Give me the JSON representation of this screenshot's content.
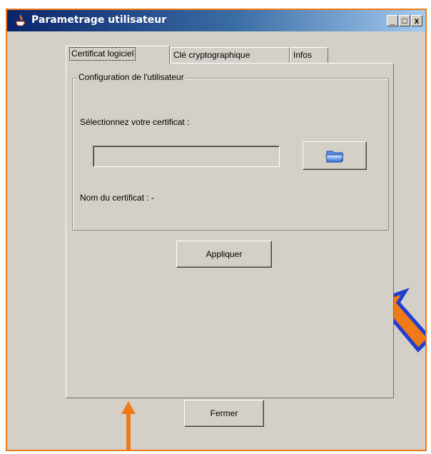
{
  "window": {
    "title": "Parametrage utilisateur",
    "controls": {
      "minimize": "_",
      "maximize": "□",
      "close": "x"
    }
  },
  "tabs": [
    {
      "label": "Certificat logiciel",
      "active": true
    },
    {
      "label": "Clé cryptographique",
      "active": false
    },
    {
      "label": "Infos",
      "active": false
    }
  ],
  "panel": {
    "group_title": "Configuration de l'utilisateur",
    "select_label": "Sélectionnez votre certificat :",
    "certificate_field_value": "",
    "browse_icon": "folder-open-icon",
    "cert_name_label": "Nom du certificat : -",
    "apply_label": "Appliquer"
  },
  "footer": {
    "close_label": "Fermer"
  },
  "colors": {
    "annotation_orange": "#f07a18",
    "annotation_blue": "#1f3fd1",
    "window_bg": "#d4d0c8",
    "titlebar_start": "#0a246a",
    "titlebar_end": "#a6caf0"
  }
}
